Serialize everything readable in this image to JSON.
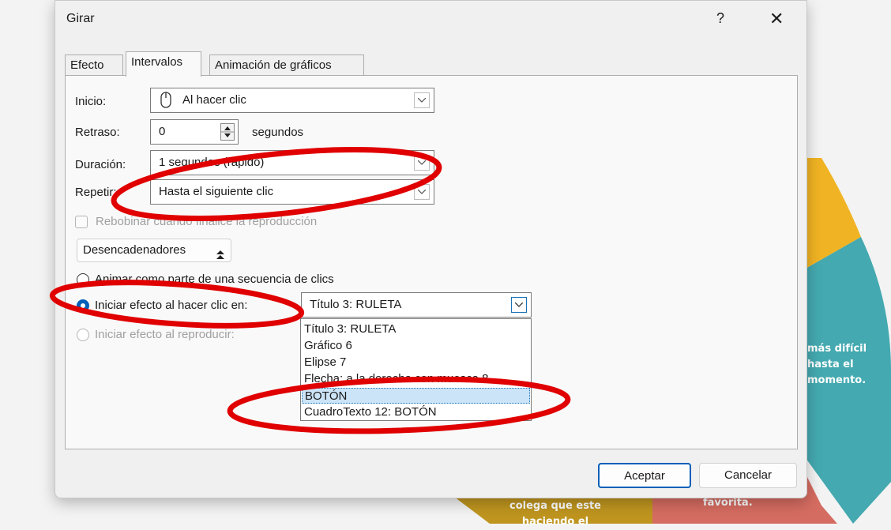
{
  "dialog": {
    "title": "Girar",
    "help_label": "?",
    "close_label": "✕"
  },
  "tabs": [
    {
      "label": "Efecto"
    },
    {
      "label": "Intervalos"
    },
    {
      "label": "Animación de gráficos"
    }
  ],
  "form": {
    "inicio_label": "Inicio:",
    "inicio_value": "Al hacer clic",
    "retraso_label": "Retraso:",
    "retraso_value": "0",
    "retraso_unit": "segundos",
    "duracion_label": "Duración:",
    "duracion_value": "1 segundos (rápido)",
    "repetir_label": "Repetir:",
    "repetir_value": "Hasta el siguiente clic",
    "rebobinar_label": "Rebobinar cuando finalice la reproducción"
  },
  "triggers": {
    "button_label": "Desencadenadores",
    "radio_sequence": "Animar como parte de una secuencia de clics",
    "radio_click": "Iniciar efecto al hacer clic en:",
    "radio_play": "Iniciar efecto al reproducir:",
    "click_combo_value": "Título 3: RULETA",
    "dropdown_items": [
      "Título 3: RULETA",
      "Gráfico 6",
      "Elipse 7",
      "Flecha: a la derecha con muesca 8",
      "BOTÓN",
      "CuadroTexto 12: BOTÓN"
    ],
    "selected_index": 4
  },
  "buttons": {
    "ok": "Aceptar",
    "cancel": "Cancelar"
  },
  "background": {
    "text_right_1": "más difícil",
    "text_right_2": "hasta el",
    "text_right_3": "momento.",
    "text_bottom_left_1": "colega que este",
    "text_bottom_left_2": "haciendo el",
    "text_bottom_right": "favorita."
  },
  "colors": {
    "accent": "#005fb8",
    "annotation": "#e00000",
    "wheel_orange": "#f0b323",
    "wheel_teal": "#44a9b0",
    "wheel_red": "#d56c61",
    "wheel_gold": "#bf951f"
  }
}
